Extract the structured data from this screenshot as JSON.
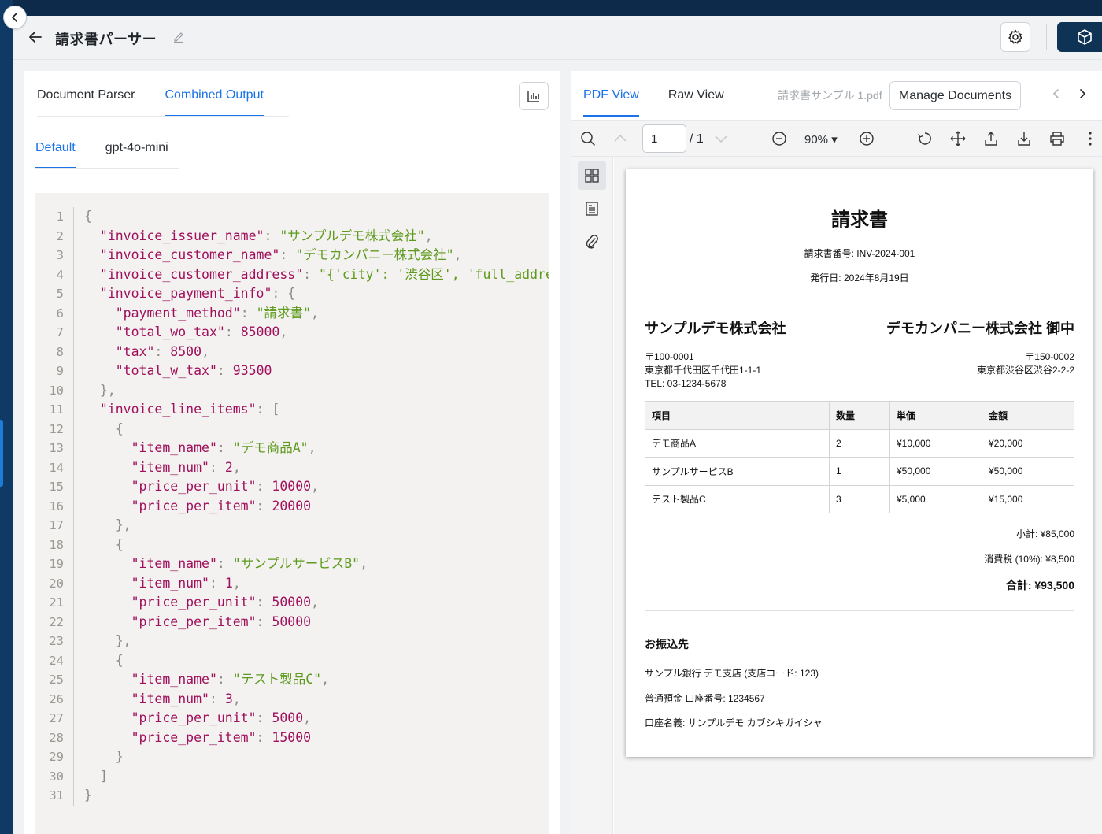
{
  "app": {
    "title": "請求書パーサー"
  },
  "left": {
    "tabs": [
      {
        "label": "Document Parser",
        "active": false
      },
      {
        "label": "Combined Output",
        "active": true
      }
    ],
    "subtabs": [
      {
        "label": "Default",
        "active": true
      },
      {
        "label": "gpt-4o-mini",
        "active": false
      }
    ]
  },
  "code_lines": [
    [
      [
        "p",
        "{"
      ]
    ],
    [
      [
        "k",
        "  \"invoice_issuer_name\""
      ],
      [
        "p",
        ": "
      ],
      [
        "s",
        "\"サンプルデモ株式会社\""
      ],
      [
        "p",
        ","
      ]
    ],
    [
      [
        "k",
        "  \"invoice_customer_name\""
      ],
      [
        "p",
        ": "
      ],
      [
        "s",
        "\"デモカンパニー株式会社\""
      ],
      [
        "p",
        ","
      ]
    ],
    [
      [
        "k",
        "  \"invoice_customer_address\""
      ],
      [
        "p",
        ": "
      ],
      [
        "s",
        "\"{'city': '渋谷区', 'full_addre"
      ]
    ],
    [
      [
        "k",
        "  \"invoice_payment_info\""
      ],
      [
        "p",
        ": {"
      ]
    ],
    [
      [
        "k",
        "    \"payment_method\""
      ],
      [
        "p",
        ": "
      ],
      [
        "s",
        "\"請求書\""
      ],
      [
        "p",
        ","
      ]
    ],
    [
      [
        "k",
        "    \"total_wo_tax\""
      ],
      [
        "p",
        ": "
      ],
      [
        "n",
        "85000"
      ],
      [
        "p",
        ","
      ]
    ],
    [
      [
        "k",
        "    \"tax\""
      ],
      [
        "p",
        ": "
      ],
      [
        "n",
        "8500"
      ],
      [
        "p",
        ","
      ]
    ],
    [
      [
        "k",
        "    \"total_w_tax\""
      ],
      [
        "p",
        ": "
      ],
      [
        "n",
        "93500"
      ]
    ],
    [
      [
        "p",
        "  },"
      ]
    ],
    [
      [
        "k",
        "  \"invoice_line_items\""
      ],
      [
        "p",
        ": ["
      ]
    ],
    [
      [
        "p",
        "    {"
      ]
    ],
    [
      [
        "k",
        "      \"item_name\""
      ],
      [
        "p",
        ": "
      ],
      [
        "s",
        "\"デモ商品A\""
      ],
      [
        "p",
        ","
      ]
    ],
    [
      [
        "k",
        "      \"item_num\""
      ],
      [
        "p",
        ": "
      ],
      [
        "n",
        "2"
      ],
      [
        "p",
        ","
      ]
    ],
    [
      [
        "k",
        "      \"price_per_unit\""
      ],
      [
        "p",
        ": "
      ],
      [
        "n",
        "10000"
      ],
      [
        "p",
        ","
      ]
    ],
    [
      [
        "k",
        "      \"price_per_item\""
      ],
      [
        "p",
        ": "
      ],
      [
        "n",
        "20000"
      ]
    ],
    [
      [
        "p",
        "    },"
      ]
    ],
    [
      [
        "p",
        "    {"
      ]
    ],
    [
      [
        "k",
        "      \"item_name\""
      ],
      [
        "p",
        ": "
      ],
      [
        "s",
        "\"サンプルサービスB\""
      ],
      [
        "p",
        ","
      ]
    ],
    [
      [
        "k",
        "      \"item_num\""
      ],
      [
        "p",
        ": "
      ],
      [
        "n",
        "1"
      ],
      [
        "p",
        ","
      ]
    ],
    [
      [
        "k",
        "      \"price_per_unit\""
      ],
      [
        "p",
        ": "
      ],
      [
        "n",
        "50000"
      ],
      [
        "p",
        ","
      ]
    ],
    [
      [
        "k",
        "      \"price_per_item\""
      ],
      [
        "p",
        ": "
      ],
      [
        "n",
        "50000"
      ]
    ],
    [
      [
        "p",
        "    },"
      ]
    ],
    [
      [
        "p",
        "    {"
      ]
    ],
    [
      [
        "k",
        "      \"item_name\""
      ],
      [
        "p",
        ": "
      ],
      [
        "s",
        "\"テスト製品C\""
      ],
      [
        "p",
        ","
      ]
    ],
    [
      [
        "k",
        "      \"item_num\""
      ],
      [
        "p",
        ": "
      ],
      [
        "n",
        "3"
      ],
      [
        "p",
        ","
      ]
    ],
    [
      [
        "k",
        "      \"price_per_unit\""
      ],
      [
        "p",
        ": "
      ],
      [
        "n",
        "5000"
      ],
      [
        "p",
        ","
      ]
    ],
    [
      [
        "k",
        "      \"price_per_item\""
      ],
      [
        "p",
        ": "
      ],
      [
        "n",
        "15000"
      ]
    ],
    [
      [
        "p",
        "    }"
      ]
    ],
    [
      [
        "p",
        "  ]"
      ]
    ],
    [
      [
        "p",
        "}"
      ]
    ]
  ],
  "right": {
    "tabs": [
      {
        "label": "PDF View",
        "active": true
      },
      {
        "label": "Raw View",
        "active": false
      }
    ],
    "filename": "請求書サンプル 1.pdf",
    "manage_label": "Manage Documents",
    "page_value": "1",
    "page_total": "/ 1",
    "zoom": "90% ▾"
  },
  "invoice": {
    "title": "請求書",
    "number": "請求書番号: INV-2024-001",
    "date": "発行日: 2024年8月19日",
    "issuer": "サンプルデモ株式会社",
    "customer": "デモカンパニー株式会社 御中",
    "issuer_addr": [
      "〒100-0001",
      "東京都千代田区千代田1-1-1",
      "TEL: 03-1234-5678"
    ],
    "customer_addr": [
      "〒150-0002",
      "東京都渋谷区渋谷2-2-2"
    ],
    "table_headers": [
      "項目",
      "数量",
      "単価",
      "金額"
    ],
    "rows": [
      [
        "デモ商品A",
        "2",
        "¥10,000",
        "¥20,000"
      ],
      [
        "サンプルサービスB",
        "1",
        "¥50,000",
        "¥50,000"
      ],
      [
        "テスト製品C",
        "3",
        "¥5,000",
        "¥15,000"
      ]
    ],
    "subtotal": "小計: ¥85,000",
    "tax": "消費税 (10%): ¥8,500",
    "total": "合計: ¥93,500",
    "bank_heading": "お振込先",
    "bank_lines": [
      "サンプル銀行 デモ支店 (支店コード: 123)",
      "普通預金 口座番号: 1234567",
      "口座名義: サンプルデモ カブシキガイシャ"
    ]
  }
}
